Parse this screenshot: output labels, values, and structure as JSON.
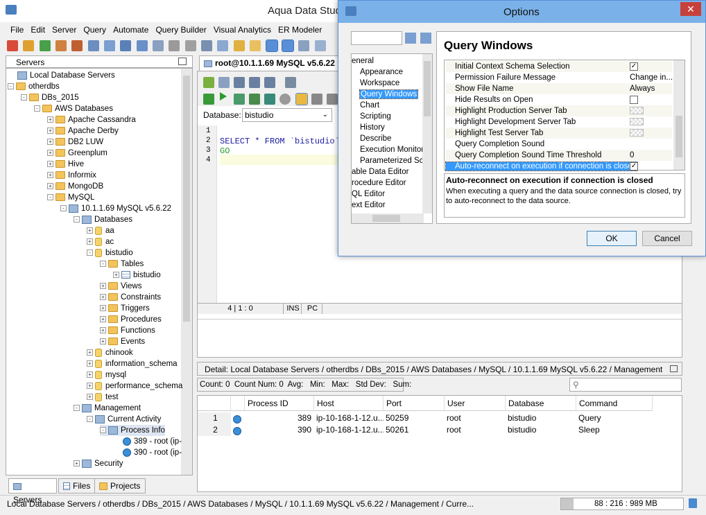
{
  "app": {
    "title": "Aqua Data Stud"
  },
  "menu": [
    "File",
    "Edit",
    "Server",
    "Query",
    "Automate",
    "Query Builder",
    "Visual Analytics",
    "ER Modeler"
  ],
  "servers_panel": {
    "title": "Servers"
  },
  "tree": [
    {
      "label": "Local Database Servers",
      "depth": 0,
      "icon": "srv",
      "exp": ""
    },
    {
      "label": "otherdbs",
      "depth": 0,
      "icon": "fold",
      "exp": "-"
    },
    {
      "label": "DBs_2015",
      "depth": 1,
      "icon": "fold",
      "exp": "-"
    },
    {
      "label": "AWS Databases",
      "depth": 2,
      "icon": "fold",
      "exp": "-"
    },
    {
      "label": "Apache Cassandra",
      "depth": 3,
      "icon": "fold",
      "exp": "+"
    },
    {
      "label": "Apache Derby",
      "depth": 3,
      "icon": "fold",
      "exp": "+"
    },
    {
      "label": "DB2 LUW",
      "depth": 3,
      "icon": "fold",
      "exp": "+"
    },
    {
      "label": "Greenplum",
      "depth": 3,
      "icon": "fold",
      "exp": "+"
    },
    {
      "label": "Hive",
      "depth": 3,
      "icon": "fold",
      "exp": "+"
    },
    {
      "label": "Informix",
      "depth": 3,
      "icon": "fold",
      "exp": "+"
    },
    {
      "label": "MongoDB",
      "depth": 3,
      "icon": "fold",
      "exp": "+"
    },
    {
      "label": "MySQL",
      "depth": 3,
      "icon": "fold",
      "exp": "-"
    },
    {
      "label": "10.1.1.69 MySQL v5.6.22",
      "depth": 4,
      "icon": "srv",
      "exp": "-"
    },
    {
      "label": "Databases",
      "depth": 5,
      "icon": "srv",
      "exp": "-"
    },
    {
      "label": "aa",
      "depth": 6,
      "icon": "db",
      "exp": "+"
    },
    {
      "label": "ac",
      "depth": 6,
      "icon": "db",
      "exp": "+"
    },
    {
      "label": "bistudio",
      "depth": 6,
      "icon": "db",
      "exp": "-"
    },
    {
      "label": "Tables",
      "depth": 7,
      "icon": "fold",
      "exp": "-"
    },
    {
      "label": "bistudio",
      "depth": 8,
      "icon": "tbl",
      "exp": "+"
    },
    {
      "label": "Views",
      "depth": 7,
      "icon": "fold",
      "exp": "+"
    },
    {
      "label": "Constraints",
      "depth": 7,
      "icon": "fold",
      "exp": "+"
    },
    {
      "label": "Triggers",
      "depth": 7,
      "icon": "fold",
      "exp": "+"
    },
    {
      "label": "Procedures",
      "depth": 7,
      "icon": "fold",
      "exp": "+"
    },
    {
      "label": "Functions",
      "depth": 7,
      "icon": "fold",
      "exp": "+"
    },
    {
      "label": "Events",
      "depth": 7,
      "icon": "fold",
      "exp": "+"
    },
    {
      "label": "chinook",
      "depth": 6,
      "icon": "db",
      "exp": "+"
    },
    {
      "label": "information_schema",
      "depth": 6,
      "icon": "db",
      "exp": "+"
    },
    {
      "label": "mysql",
      "depth": 6,
      "icon": "db",
      "exp": "+"
    },
    {
      "label": "performance_schema",
      "depth": 6,
      "icon": "db",
      "exp": "+"
    },
    {
      "label": "test",
      "depth": 6,
      "icon": "db",
      "exp": "+"
    },
    {
      "label": "Management",
      "depth": 5,
      "icon": "srv",
      "exp": "-"
    },
    {
      "label": "Current Activity",
      "depth": 6,
      "icon": "srv",
      "exp": "-"
    },
    {
      "label": "Process Info",
      "depth": 7,
      "icon": "srv",
      "exp": "-"
    },
    {
      "label": "389 - root (ip-",
      "depth": 8,
      "icon": "glob",
      "exp": ""
    },
    {
      "label": "390 - root (ip-",
      "depth": 8,
      "icon": "glob",
      "exp": ""
    },
    {
      "label": "Security",
      "depth": 5,
      "icon": "srv",
      "exp": "+"
    }
  ],
  "bottom_tabs": [
    "Servers",
    "Files",
    "Projects"
  ],
  "editor": {
    "tab_label": "root@10.1.1.69 MySQL v5.6.22",
    "database_label": "Database:",
    "database_value": "bistudio",
    "lines": [
      {
        "num": "1",
        "text": ""
      },
      {
        "num": "2",
        "text": "SELECT * FROM `bistudio`"
      },
      {
        "num": "3",
        "text": "GO"
      },
      {
        "num": "4",
        "text": ""
      }
    ],
    "status_pos": "4 | 1 : 0",
    "status_ins": "INS",
    "status_pc": "PC"
  },
  "detail": {
    "path": "Detail: Local Database Servers / otherdbs / DBs_2015 / AWS Databases / MySQL / 10.1.1.69 MySQL v5.6.22 / Management / Current ...",
    "stats": "Count: 0  Count Num: 0  Avg:   Min:   Max:   Std Dev:   Sum:",
    "columns": [
      "",
      "",
      "Process ID",
      "Host",
      "Port",
      "User",
      "Database",
      "Command"
    ],
    "rows": [
      [
        "1",
        "",
        "389",
        "ip-10-168-1-12.u...",
        "50259",
        "root",
        "bistudio",
        "Query"
      ],
      [
        "2",
        "",
        "390",
        "ip-10-168-1-12.u...",
        "50261",
        "root",
        "bistudio",
        "Sleep"
      ]
    ]
  },
  "statusbar": {
    "path": "Local Database Servers / otherdbs / DBs_2015 / AWS Databases / MySQL / 10.1.1.69 MySQL v5.6.22 / Management / Curre...",
    "memory": "88 : 216 : 989 MB"
  },
  "dialog": {
    "title": "Options",
    "heading": "Query Windows",
    "nav": [
      {
        "label": "eneral",
        "indent": 0,
        "selected": false
      },
      {
        "label": "Appearance",
        "indent": 1,
        "selected": false
      },
      {
        "label": "Workspace",
        "indent": 1,
        "selected": false
      },
      {
        "label": "Query Windows",
        "indent": 1,
        "selected": true
      },
      {
        "label": "Chart",
        "indent": 1,
        "selected": false
      },
      {
        "label": "Scripting",
        "indent": 1,
        "selected": false
      },
      {
        "label": "History",
        "indent": 1,
        "selected": false
      },
      {
        "label": "Describe",
        "indent": 1,
        "selected": false
      },
      {
        "label": "Execution Monitor",
        "indent": 1,
        "selected": false
      },
      {
        "label": "Parameterized Scr",
        "indent": 1,
        "selected": false
      },
      {
        "label": "able Data Editor",
        "indent": 0,
        "selected": false
      },
      {
        "label": "rocedure Editor",
        "indent": 0,
        "selected": false
      },
      {
        "label": "QL Editor",
        "indent": 0,
        "selected": false
      },
      {
        "label": "ext Editor",
        "indent": 0,
        "selected": false
      }
    ],
    "props": [
      {
        "name": "Initial Context Schema Selection",
        "type": "check",
        "value": "✓"
      },
      {
        "name": "Permission Failure Message",
        "type": "text",
        "value": "Change in..."
      },
      {
        "name": "Show File Name",
        "type": "text",
        "value": "Always"
      },
      {
        "name": "Hide Results on Open",
        "type": "check",
        "value": ""
      },
      {
        "name": "Highlight Production Server Tab",
        "type": "swatch",
        "value": ""
      },
      {
        "name": "Highlight Development Server Tab",
        "type": "swatch",
        "value": ""
      },
      {
        "name": "Highlight Test Server Tab",
        "type": "swatch",
        "value": ""
      },
      {
        "name": "Query Completion Sound",
        "type": "text",
        "value": ""
      },
      {
        "name": "Query Completion Sound Time Threshold",
        "type": "text",
        "value": "0"
      },
      {
        "name": "Auto-reconnect on execution if connection is closed",
        "type": "check",
        "value": "✓",
        "selected": true
      }
    ],
    "desc_title": "Auto-reconnect on execution if connection is closed",
    "desc_text": "When executing a query and the data source connection is closed, try to auto-reconnect to the data source.",
    "ok": "OK",
    "cancel": "Cancel"
  }
}
